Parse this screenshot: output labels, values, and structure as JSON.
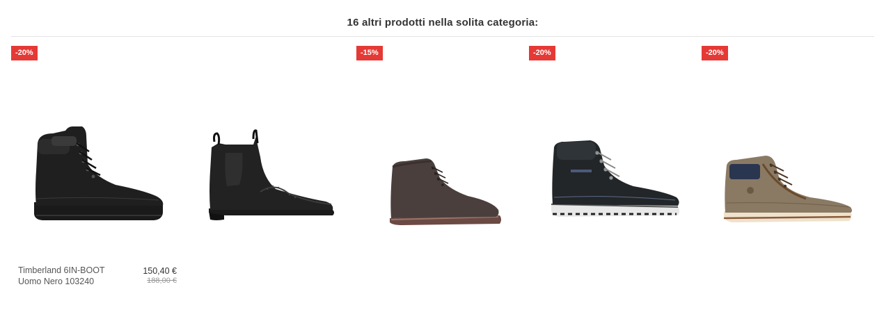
{
  "section": {
    "title": "16 altri prodotti nella solita categoria:"
  },
  "products": [
    {
      "badge": "-20%",
      "name_line1": "Timberland 6IN-BOOT",
      "name_line2": "Uomo Nero 103240",
      "price": "150,40 €",
      "old_price": "188,00 €",
      "image_icon": "black-lace-up-boot-icon"
    },
    {
      "badge": "",
      "image_icon": "black-chelsea-brogue-boot-icon"
    },
    {
      "badge": "-15%",
      "image_icon": "brown-suede-ankle-boot-icon"
    },
    {
      "badge": "-20%",
      "image_icon": "black-hiking-boot-icon"
    },
    {
      "badge": "-20%",
      "image_icon": "brown-high-top-sneaker-icon"
    }
  ],
  "colors": {
    "badge": "#e53935",
    "divider": "#e3e3e3"
  }
}
